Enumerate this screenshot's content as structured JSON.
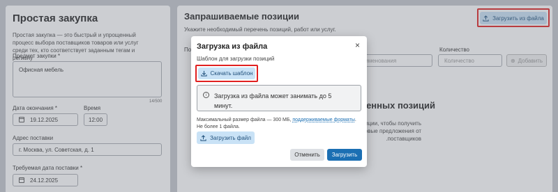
{
  "left": {
    "title": "Простая закупка",
    "description": "Простая закупка — это быстрый и упрощенный процесс выбора поставщиков товаров или услуг среди тех, кто соответствует заданным тегам и региону",
    "subject_label": "Предмет закупки *",
    "subject_value": "Офисная мебель",
    "subject_counter": "14/500",
    "end_date_label": "Дата окончания *",
    "end_date_value": "19.12.2025",
    "time_label": "Время",
    "time_value": "12:00",
    "address_label": "Адрес поставки",
    "address_value": "г. Москва, ул. Советская, д. 1",
    "delivery_date_label": "Требуемая дата поставки *",
    "delivery_date_value": "24.12.2025"
  },
  "right": {
    "title": "Запрашиваемые позиции",
    "subtitle": "Укажите необходимый перечень позиций, работ или услуг.",
    "upload_button": "Загрузить из файла",
    "col_name": "Наименования",
    "col_name_partial": "По",
    "col_qty": "Количество",
    "name_placeholder": "Наименования",
    "qty_placeholder": "Количество",
    "add_button": "Добавить",
    "empty_title": "Нет добавленных позиций",
    "empty_text": "Добавьте позиции, чтобы получить ценовые предложения от поставщиков."
  },
  "modal": {
    "title": "Загрузка из файла",
    "close": "×",
    "template_label": "Шаблон для загрузки позиций",
    "download_button": "Скачать шаблон",
    "info_text": "Загрузка из файла может занимать до 5 минут.",
    "size_note_1": "Максимальный размер файла — 300 МБ,",
    "size_note_link": "поддерживаемые форматы",
    "size_note_2": ". Не более 1 файла.",
    "upload_file_button": "Загрузить файл",
    "cancel_button": "Отменить",
    "submit_button": "Загрузить"
  },
  "colors": {
    "primary": "#1b6fb3",
    "light_button": "#c9e2f6",
    "highlight_frame": "#e02020"
  }
}
